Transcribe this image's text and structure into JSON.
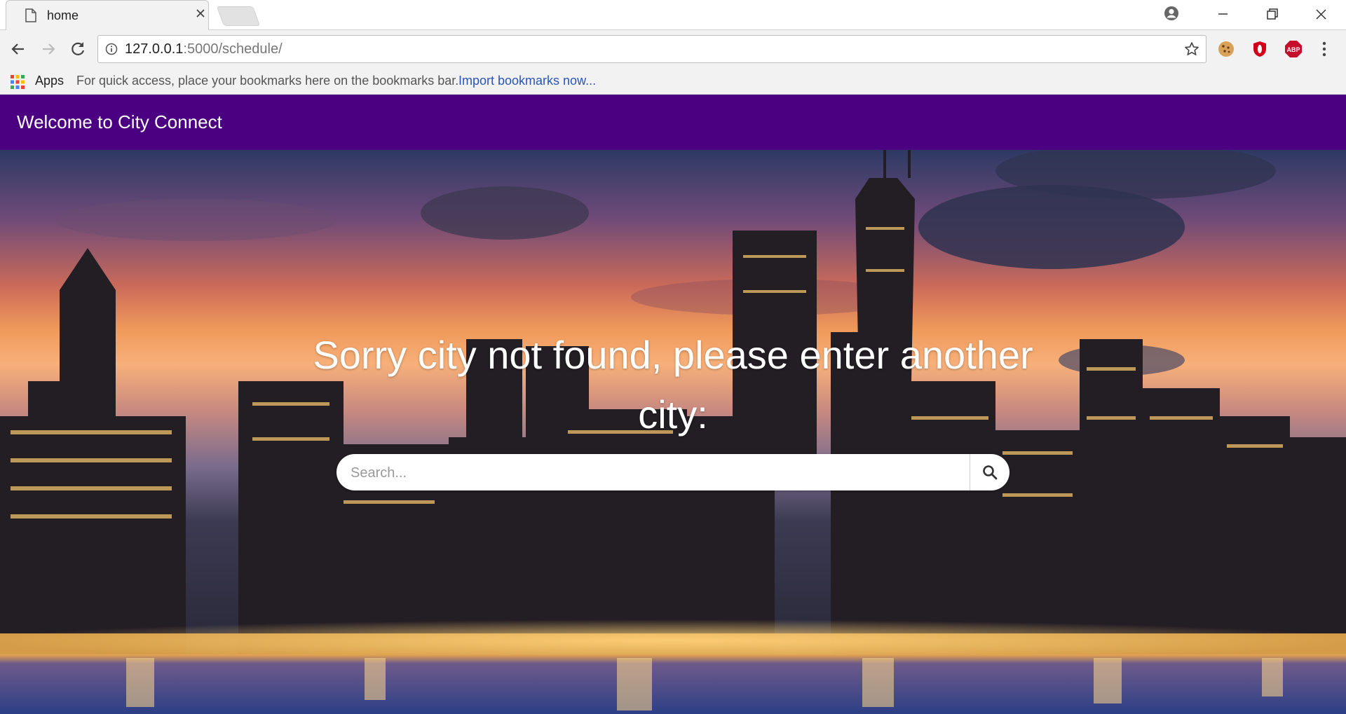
{
  "browser": {
    "tab_title": "home",
    "url_host": "127.0.0.1",
    "url_path": ":5000/schedule/",
    "icons": {
      "tab_page": "page-icon",
      "tab_close": "close-icon",
      "profile": "profile-icon",
      "back": "back-arrow-icon",
      "forward": "forward-arrow-icon",
      "reload": "reload-icon",
      "site_info": "info-icon",
      "bookmark_star": "star-icon",
      "extensions": [
        "cookie-icon",
        "opera-icon",
        "abp-icon"
      ],
      "menu": "kebab-menu-icon"
    },
    "extension_labels": {
      "abp": "ABP"
    }
  },
  "bookmarks_bar": {
    "apps_label": "Apps",
    "hint": "For quick access, place your bookmarks here on the bookmarks bar.",
    "import_link": "Import bookmarks now..."
  },
  "header": {
    "brand": "Welcome to City Connect"
  },
  "hero": {
    "message": "Sorry city not found, please enter another city:",
    "search_placeholder": "Search...",
    "search_icon": "magnifier-icon"
  },
  "colors": {
    "header_bg": "#4b0082",
    "link": "#2a55b8"
  }
}
